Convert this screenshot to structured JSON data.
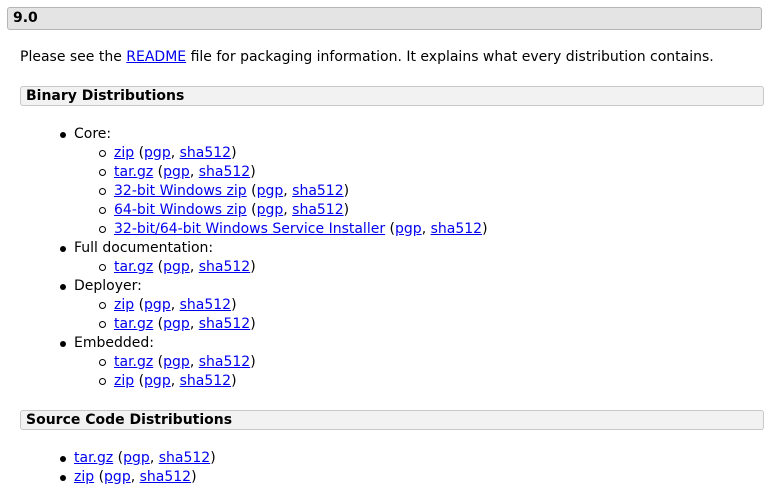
{
  "version": {
    "title": "9.0"
  },
  "intro": {
    "prefix": "Please see the ",
    "link": "README",
    "suffix": " file for packaging information. It explains what every distribution contains."
  },
  "binary": {
    "heading": "Binary Distributions",
    "groups": [
      {
        "label": "Core:",
        "items": [
          {
            "name": "zip",
            "pgp": "pgp",
            "sha": "sha512"
          },
          {
            "name": "tar.gz",
            "pgp": "pgp",
            "sha": "sha512"
          },
          {
            "name": "32-bit Windows zip",
            "pgp": "pgp",
            "sha": "sha512"
          },
          {
            "name": "64-bit Windows zip",
            "pgp": "pgp",
            "sha": "sha512"
          },
          {
            "name": "32-bit/64-bit Windows Service Installer",
            "pgp": "pgp",
            "sha": "sha512"
          }
        ]
      },
      {
        "label": "Full documentation:",
        "items": [
          {
            "name": "tar.gz",
            "pgp": "pgp",
            "sha": "sha512"
          }
        ]
      },
      {
        "label": "Deployer:",
        "items": [
          {
            "name": "zip",
            "pgp": "pgp",
            "sha": "sha512"
          },
          {
            "name": "tar.gz",
            "pgp": "pgp",
            "sha": "sha512"
          }
        ]
      },
      {
        "label": "Embedded:",
        "items": [
          {
            "name": "tar.gz",
            "pgp": "pgp",
            "sha": "sha512"
          },
          {
            "name": "zip",
            "pgp": "pgp",
            "sha": "sha512"
          }
        ]
      }
    ]
  },
  "source": {
    "heading": "Source Code Distributions",
    "items": [
      {
        "name": "tar.gz",
        "pgp": "pgp",
        "sha": "sha512"
      },
      {
        "name": "zip",
        "pgp": "pgp",
        "sha": "sha512"
      }
    ]
  },
  "punct": {
    "open": " (",
    "sep": ", ",
    "close": ")"
  },
  "colors": {
    "link": "#0000ee",
    "bar_bg": "#e4e4e4",
    "section_bg": "#f2f2f2"
  }
}
